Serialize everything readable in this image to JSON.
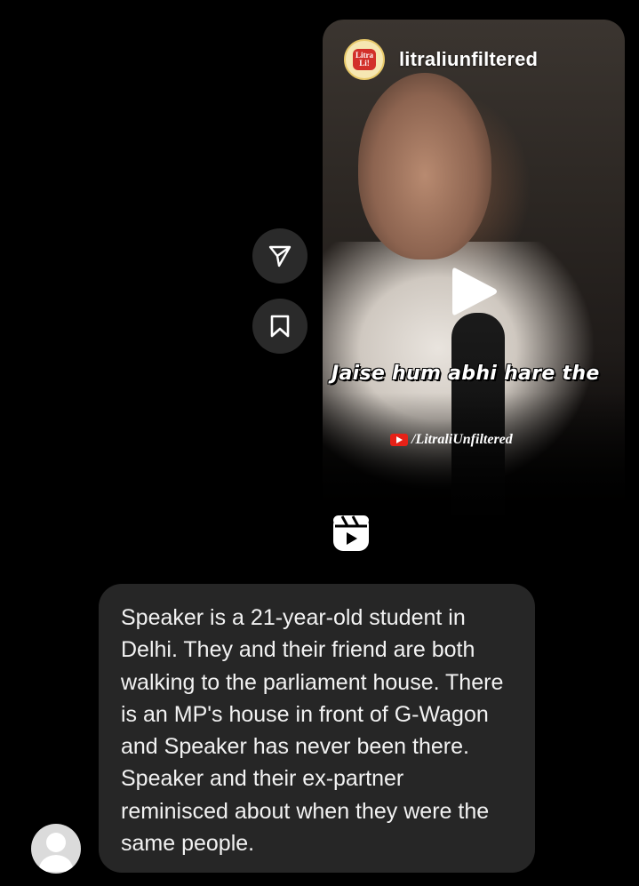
{
  "reel": {
    "channel_name": "litraliunfiltered",
    "channel_logo_text": "LitraLi Unfiltered",
    "caption": "Jaise hum abhi hare the",
    "yt_handle": "/LitraliUnfiltered",
    "play_icon": "play-icon",
    "type_icon": "reels-icon"
  },
  "actions": {
    "share_icon": "paper-plane-icon",
    "save_icon": "bookmark-icon"
  },
  "message": {
    "text": "Speaker is a 21-year-old student in Delhi. They and their friend are both walking to the parliament house. There is an MP's house in front of G-Wagon and Speaker has never been there. Speaker and their ex-partner reminisced about when they were the same people."
  },
  "colors": {
    "background": "#000000",
    "bubble": "#262626",
    "action_button": "#2a2a2a",
    "youtube_red": "#e62117"
  }
}
